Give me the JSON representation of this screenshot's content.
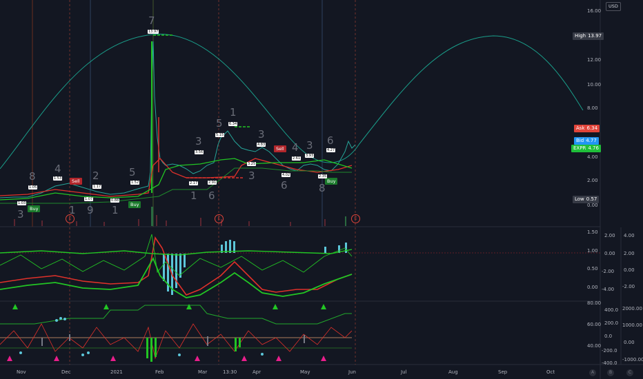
{
  "currency": "USD",
  "price_axis": [
    "16.00",
    "12.00",
    "10.00",
    "8.00",
    "4.00",
    "2.00",
    "0.00"
  ],
  "tags": {
    "high": {
      "name": "High",
      "value": "13.97",
      "color": "#363a45"
    },
    "ask": {
      "name": "Ask",
      "value": "6.34",
      "color": "#e0443a"
    },
    "bid": {
      "name": "Bid",
      "value": "4.77",
      "color": "#2196f3"
    },
    "symbol": {
      "name": "EXPR",
      "value": "4.76",
      "color": "#1fbf3a"
    },
    "low": {
      "name": "Low",
      "value": "0.57",
      "color": "#363a45"
    }
  },
  "osc1_axis_a": [
    "1.50",
    "1.00",
    "0.50",
    "0.00"
  ],
  "osc1_axis_b": [
    "2.00",
    "0.00",
    "-2.00",
    "-4.00"
  ],
  "osc1_axis_c": [
    "4.00",
    "2.00",
    "0.00",
    "-2.00"
  ],
  "osc2_axis_a": [
    "80.00",
    "60.00",
    "40.00"
  ],
  "osc2_axis_b": [
    "400.0",
    "200.0",
    "0.0",
    "-200.0",
    "-400.0"
  ],
  "osc2_axis_c": [
    "2000.00",
    "1000.00",
    "0.00",
    "-1000.00"
  ],
  "months": [
    "Nov",
    "Dec",
    "2021",
    "Feb",
    "Mar",
    "13:30",
    "Apr",
    "May",
    "Jun",
    "Jul",
    "Aug",
    "Sep",
    "Oct"
  ],
  "scale_buttons": [
    "A",
    "B",
    "C"
  ],
  "wave_counts": [
    "8",
    "4",
    "2",
    "5",
    "7",
    "3",
    "5",
    "1",
    "3",
    "4",
    "3",
    "6",
    "3",
    "1",
    "9",
    "1",
    "1",
    "6",
    "3",
    "6",
    "8"
  ],
  "signals": {
    "buy": "Buy",
    "sell": "Sell"
  },
  "mini_labels": [
    "1.03",
    "1.05",
    "1.53",
    "1.07",
    "1.17",
    "0.88",
    "1.52",
    "13.97",
    "3.56",
    "2.17",
    "5.15",
    "2.91",
    "6.34",
    "3.25",
    "4.83",
    "4.02",
    "2.61",
    "3.93",
    "2.35",
    "4.27"
  ],
  "earnings": "E",
  "colors": {
    "bg": "#131722",
    "grid": "#1e222d",
    "green": "#22c524",
    "red": "#e0312a",
    "teal": "#1a9e8a",
    "cyan": "#5cc6d9"
  }
}
